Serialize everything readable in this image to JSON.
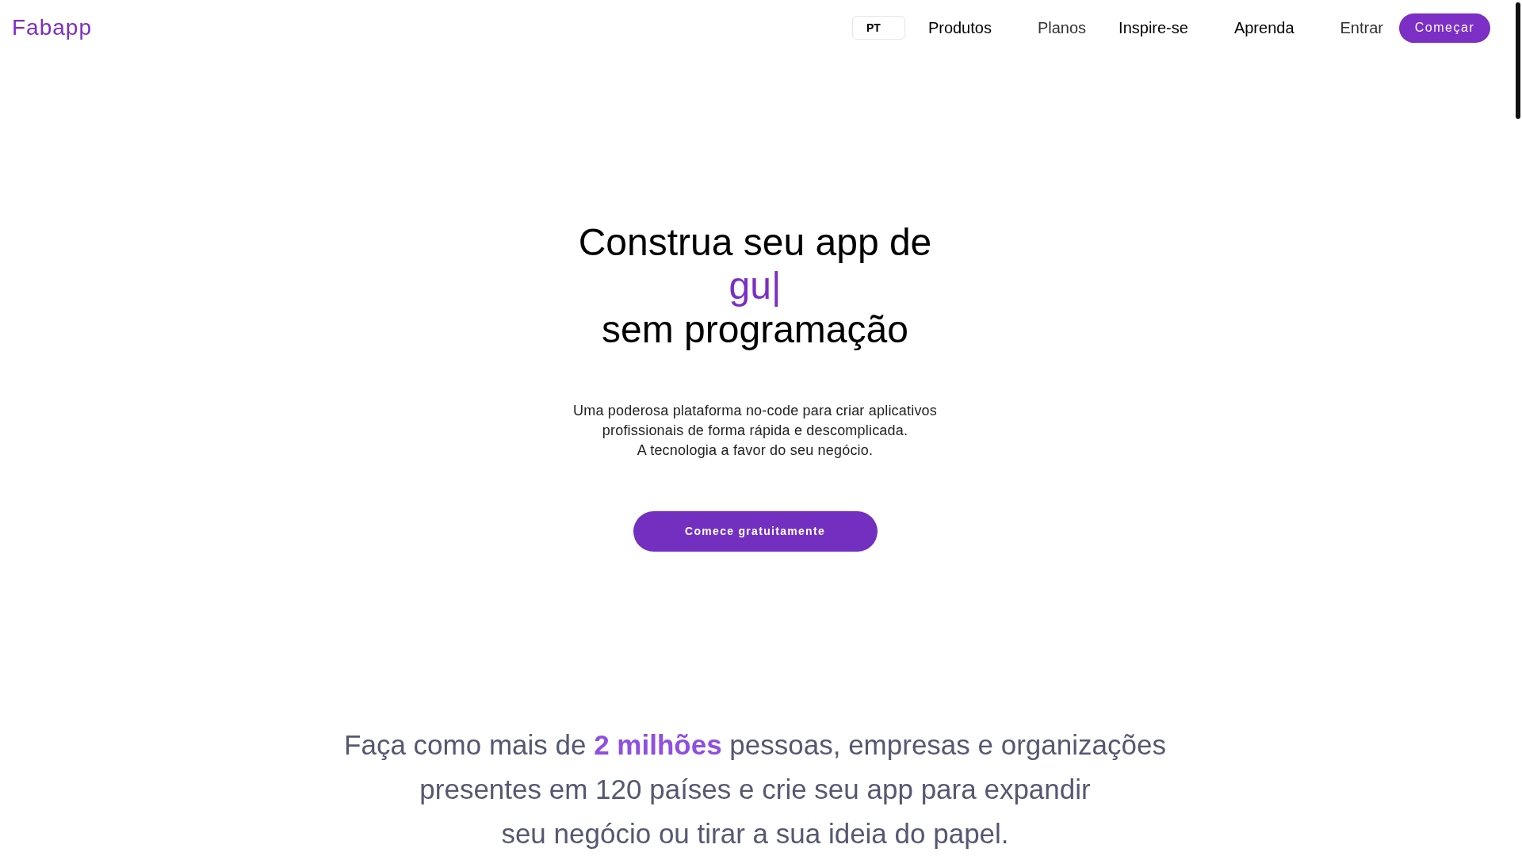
{
  "header": {
    "logo": "Fabapp",
    "language": "PT",
    "nav": [
      {
        "label": "Produtos",
        "kind": "menu"
      },
      {
        "label": "Planos",
        "kind": "link"
      },
      {
        "label": "Inspire-se",
        "kind": "menu"
      },
      {
        "label": "Aprenda",
        "kind": "menu"
      }
    ],
    "login": "Entrar",
    "cta": "Começar"
  },
  "hero": {
    "heading": {
      "before": "Construa seu app de",
      "typed": "gu",
      "cursor": "|",
      "after": "sem programação"
    },
    "subtitle_lines": [
      "Uma poderosa plataforma no-code para criar aplicativos",
      "profissionais de forma rápida e descomplicada.",
      "A tecnologia a favor do seu negócio."
    ],
    "cta": "Comece gratuitamente"
  },
  "social_proof": {
    "lines": [
      "Faça como mais de **2 milhões** pessoas, empresas e organizações",
      "presentes em 120 países e crie seu app para expandir",
      "seu negócio ou tirar a sua ideia do papel."
    ]
  }
}
